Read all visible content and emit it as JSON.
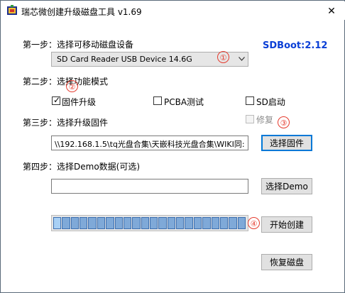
{
  "window": {
    "title": "瑞芯微创建升级磁盘工具 v1.69",
    "close_glyph": "✕"
  },
  "sdboot_label": "SDBoot:2.12",
  "step1": {
    "label": "第一步：选择可移动磁盘设备",
    "device_selected": "SD Card Reader USB Device   14.6G",
    "badge": "①"
  },
  "step2": {
    "label": "第二步：选择功能模式",
    "badge": "②",
    "options": [
      {
        "label": "固件升级",
        "checked": true
      },
      {
        "label": "PCBA测试",
        "checked": false
      },
      {
        "label": "SD启动",
        "checked": false
      }
    ]
  },
  "step3": {
    "label": "第三步：选择升级固件",
    "repair_label": "修复",
    "repair_checked": false,
    "badge": "③",
    "firmware_path": "\\\\192.168.1.5\\tq光盘合集\\天嵌科技光盘合集\\WIKI同:",
    "button_label": "选择固件"
  },
  "step4": {
    "label": "第四步：选择Demo数据(可选)",
    "demo_path": "",
    "button_label": "选择Demo",
    "badge": "④",
    "start_button_label": "开始创建",
    "progress_fraction": 1.0,
    "progress_segments": 22
  },
  "restore_button_label": "恢复磁盘",
  "colors": {
    "accent_blue": "#0a3fd6",
    "badge_red": "#e53b2e",
    "progress_fill": "#7fa9d8"
  }
}
